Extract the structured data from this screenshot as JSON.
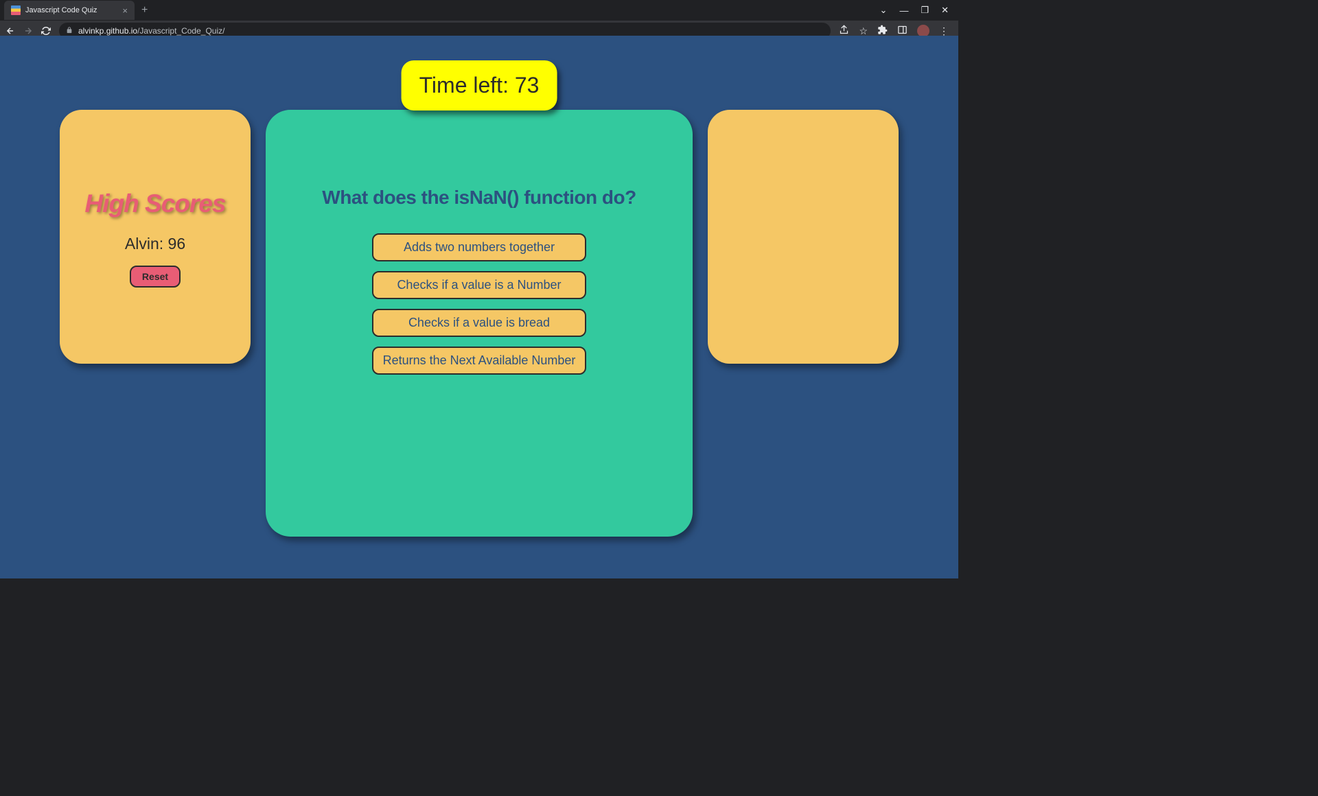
{
  "browser": {
    "tab_title": "Javascript Code Quiz",
    "url_domain": "alvinkp.github.io",
    "url_path": "/Javascript_Code_Quiz/"
  },
  "timer": {
    "label": "Time left: ",
    "value": "73"
  },
  "highscores": {
    "title": "High Scores",
    "entries": [
      {
        "text": "Alvin: 96"
      }
    ],
    "reset_label": "Reset"
  },
  "quiz": {
    "question": "What does the isNaN() function do?",
    "answers": [
      "Adds two numbers together",
      "Checks if a value is a Number",
      "Checks if a value is bread",
      "Returns the Next Available Number"
    ]
  }
}
